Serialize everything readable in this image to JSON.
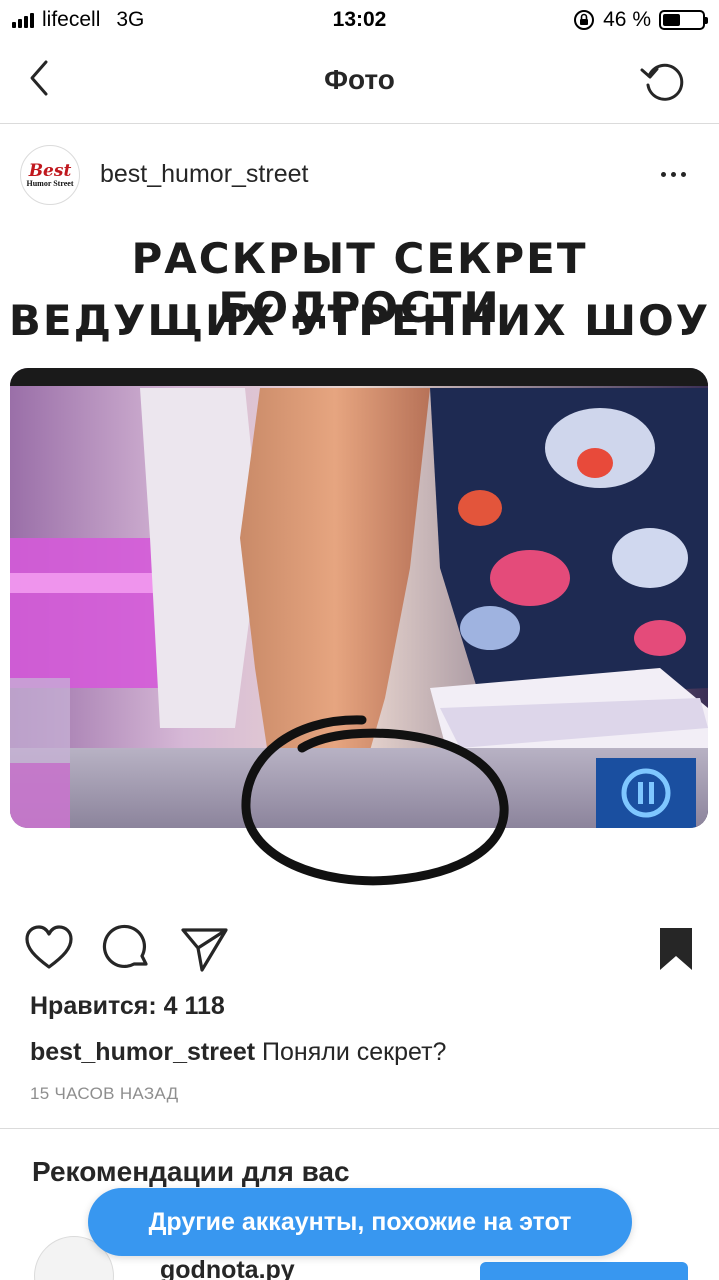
{
  "status_bar": {
    "carrier": "lifecell",
    "network": "3G",
    "time": "13:02",
    "battery_percent": "46 %",
    "battery_level": 0.46
  },
  "nav": {
    "title": "Фото",
    "back_icon": "chevron-left-icon",
    "refresh_icon": "refresh-icon"
  },
  "post": {
    "avatar": {
      "text_main": "Best",
      "text_sub": "Humor Street"
    },
    "username": "best_humor_street",
    "more_icon": "more-horizontal-icon",
    "image": {
      "headline_line1": "РАСКРЫТ СЕКРЕТ БОДРОСТИ",
      "headline_line2": "ВЕДУЩИХ УТРЕННИХ ШОУ"
    },
    "actions": {
      "like_icon": "heart-icon",
      "comment_icon": "comment-icon",
      "share_icon": "paper-plane-icon",
      "save_icon": "bookmark-icon"
    },
    "likes_text": "Нравится: 4 118",
    "caption": {
      "username": "best_humor_street",
      "text": "Поняли секрет?"
    },
    "time_ago": "15 ЧАСОВ НАЗАД"
  },
  "recommendations": {
    "title": "Рекомендации для вас",
    "pill_label": "Другие аккаунты, похожие на этот",
    "items": [
      {
        "name": "godnota.py"
      }
    ]
  },
  "colors": {
    "accent": "#3897f0",
    "text": "#262626",
    "secondary_text": "#8e8e8e",
    "divider": "#dbdbdb"
  }
}
